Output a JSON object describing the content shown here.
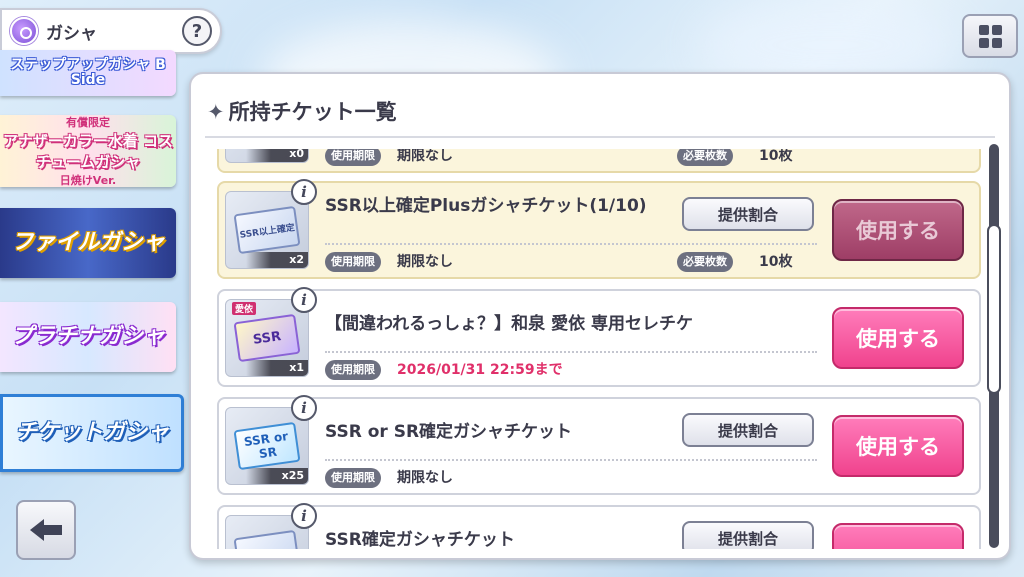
{
  "header": {
    "title": "ガシャ",
    "help_label": "?"
  },
  "sidebar": {
    "banners": [
      {
        "label": "ステップアップガシャ B Side"
      },
      {
        "top": "有償限定",
        "main": "アナザーカラー水着 コスチュームガシャ",
        "sub": "日焼けVer."
      },
      {
        "label": "ファイルガシャ"
      },
      {
        "label": "プラチナガシャ"
      },
      {
        "label": "チケットガシャ"
      }
    ]
  },
  "panel": {
    "title": "所持チケット一覧",
    "title_icon": "sparkle-icon"
  },
  "labels": {
    "expiry": "使用期限",
    "required": "必要枚数",
    "rates": "提供割合",
    "use": "使用する"
  },
  "tickets": [
    {
      "name": "",
      "qty": "x0",
      "expiry": "期限なし",
      "required": "10枚"
    },
    {
      "name": "SSR以上確定Plusガシャチケット(1/10)",
      "qty": "x2",
      "expiry": "期限なし",
      "required": "10枚",
      "thumb": "SSR以上確定",
      "use_enabled": false
    },
    {
      "name": "【間違われるっしょ？】和泉 愛依 専用セレチケ",
      "qty": "x1",
      "expiry": "2026/01/31 22:59まで",
      "thumb": "SSR",
      "tag": "愛依",
      "use_enabled": true
    },
    {
      "name": "SSR or SR確定ガシャチケット",
      "qty": "x25",
      "expiry": "期限なし",
      "thumb": "SSR or SR",
      "use_enabled": true
    },
    {
      "name": "SSR確定ガシャチケット"
    }
  ],
  "colors": {
    "accent_pink": "#f0438d",
    "expiry_red": "#e0306a"
  }
}
